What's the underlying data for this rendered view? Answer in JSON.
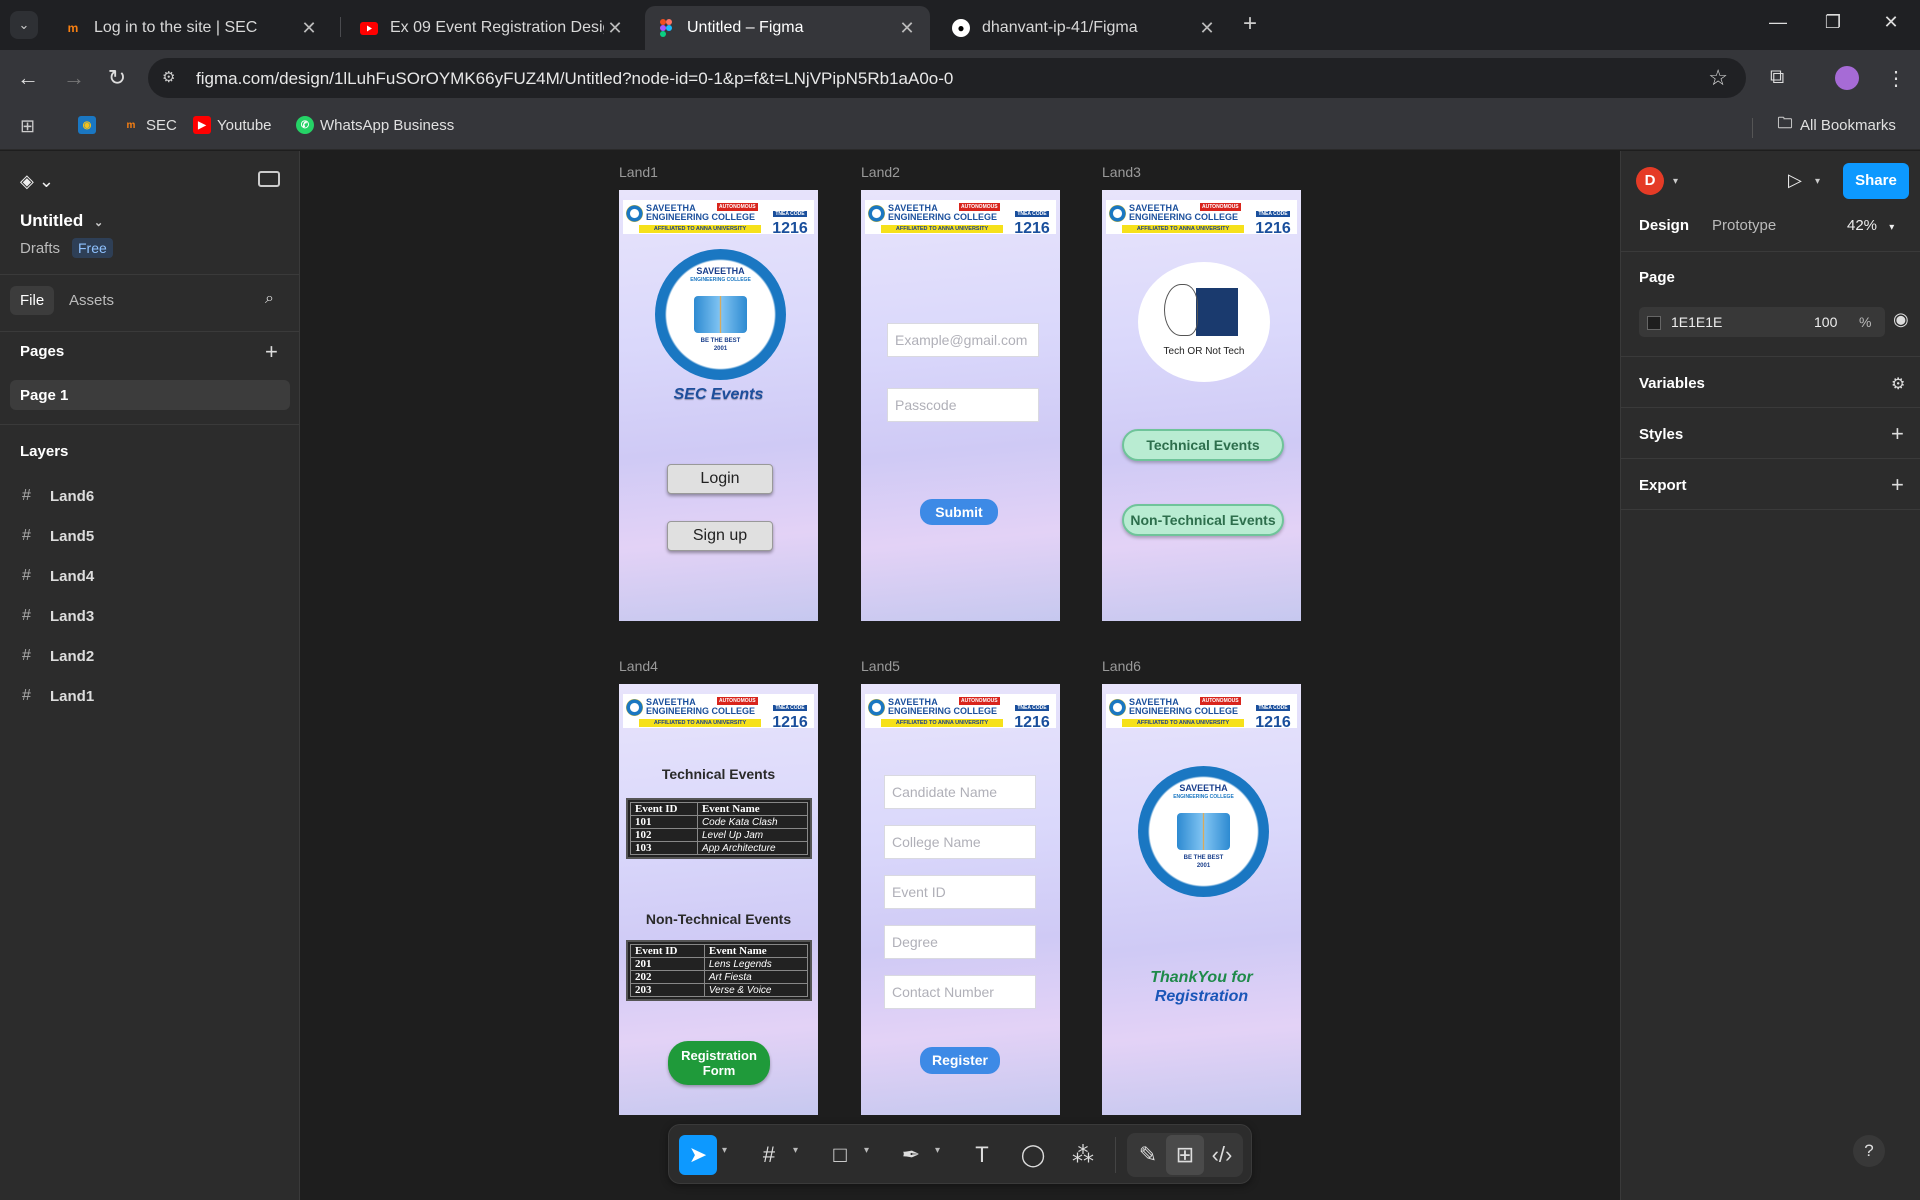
{
  "browser": {
    "tabs": [
      {
        "title": "Log in to the site | SEC",
        "icon": "moodle-icon"
      },
      {
        "title": "Ex 09 Event Registration Design",
        "icon": "youtube-icon"
      },
      {
        "title": "Untitled – Figma",
        "icon": "figma-icon",
        "active": true
      },
      {
        "title": "dhanvant-ip-41/Figma",
        "icon": "github-icon"
      }
    ],
    "url": "figma.com/design/1lLuhFuSOrOYMK66yFUZ4M/Untitled?node-id=0-1&p=f&t=LNjVPipN5Rb1aA0o-0",
    "bookmarks": [
      "SEC",
      "Youtube",
      "WhatsApp Business"
    ],
    "all_bookmarks": "All Bookmarks"
  },
  "left_panel": {
    "file_title": "Untitled",
    "drafts": "Drafts",
    "plan_badge": "Free",
    "tabs": [
      "File",
      "Assets"
    ],
    "pages_heading": "Pages",
    "pages": [
      "Page 1"
    ],
    "layers_heading": "Layers",
    "layers": [
      "Land6",
      "Land5",
      "Land4",
      "Land3",
      "Land2",
      "Land1"
    ]
  },
  "canvas": {
    "college": {
      "name_line1": "SAVEETHA",
      "name_line2": "ENGINEERING COLLEGE",
      "autonomous": "AUTONOMOUS",
      "affiliated": "AFFILIATED TO ANNA UNIVERSITY",
      "code_label": "TNEA CODE",
      "code": "1216",
      "logo_top": "SAVEETHA",
      "logo_sub": "ENGINEERING COLLEGE",
      "logo_motto": "BE THE BEST",
      "logo_year": "2001"
    },
    "frames": {
      "land1": {
        "label": "Land1",
        "app_title": "SEC Events",
        "login": "Login",
        "signup": "Sign up"
      },
      "land2": {
        "label": "Land2",
        "email_placeholder": "Example@gmail.com",
        "passcode_placeholder": "Passcode",
        "submit": "Submit"
      },
      "land3": {
        "label": "Land3",
        "tech_logo_text": "Tech OR Not Tech",
        "technical": "Technical Events",
        "non_technical": "Non-Technical Events"
      },
      "land4": {
        "label": "Land4",
        "technical_title": "Technical Events",
        "non_technical_title": "Non-Technical Events",
        "col_id": "Event ID",
        "col_name": "Event Name",
        "technical_rows": [
          [
            "101",
            "Code Kata Clash"
          ],
          [
            "102",
            "Level Up Jam"
          ],
          [
            "103",
            "App Architecture"
          ]
        ],
        "non_technical_rows": [
          [
            "201",
            "Lens Legends"
          ],
          [
            "202",
            "Art Fiesta"
          ],
          [
            "203",
            "Verse & Voice"
          ]
        ],
        "registration_button": "Registration Form"
      },
      "land5": {
        "label": "Land5",
        "fields": [
          "Candidate Name",
          "College Name",
          "Event ID",
          "Degree",
          "Contact Number"
        ],
        "register": "Register"
      },
      "land6": {
        "label": "Land6",
        "thanks_line1": "ThankYou for",
        "thanks_line2": "Registration"
      }
    }
  },
  "right_panel": {
    "avatar_initial": "D",
    "share": "Share",
    "tabs": [
      "Design",
      "Prototype"
    ],
    "zoom": "42%",
    "page_heading": "Page",
    "page_color": "1E1E1E",
    "page_opacity": "100",
    "percent": "%",
    "variables": "Variables",
    "styles": "Styles",
    "export": "Export"
  },
  "help": "?"
}
